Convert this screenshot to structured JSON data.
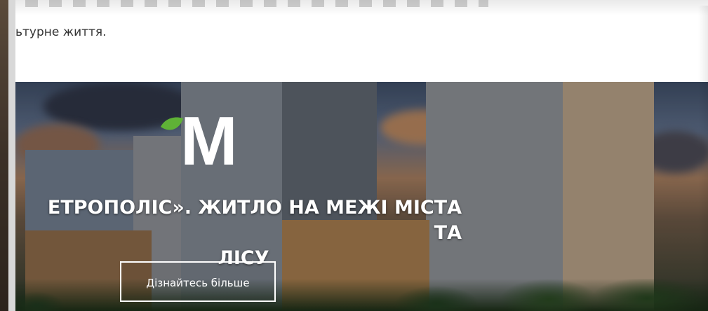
{
  "intro": {
    "text": "ьтурне життя."
  },
  "hero": {
    "logo_letter": "M",
    "title_line1": "ЕТРОПОЛІС». ЖИТЛО НА МЕЖІ МІСТА ТА",
    "title_line2": "ЛІСУ",
    "cta_label": "Дізнайтесь більше"
  },
  "colors": {
    "logo_leaf": "#5fb236",
    "text_dark": "#333333",
    "hero_text": "#ffffff"
  }
}
